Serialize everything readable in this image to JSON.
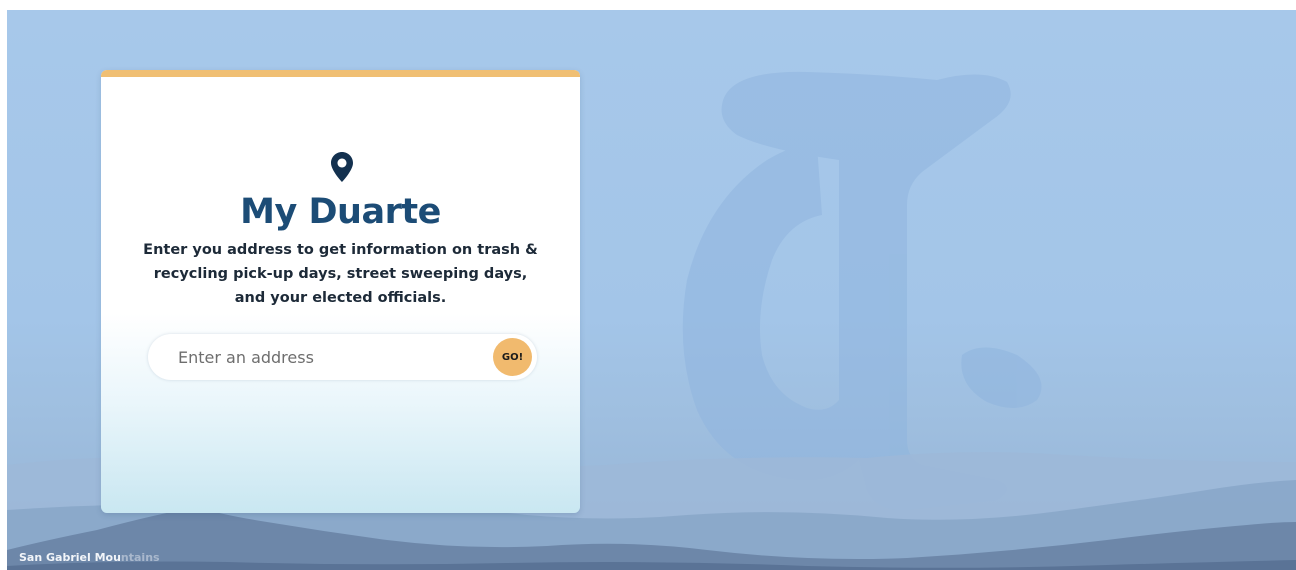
{
  "card": {
    "title": "My Duarte",
    "description": "Enter you address to get information on trash & recycling pick-up days, street sweeping days, and your elected officials."
  },
  "search": {
    "placeholder": "Enter an address",
    "value": "",
    "go_label": "GO!"
  },
  "photo_caption": {
    "visible": "San Gabriel Mou",
    "faded": "ntains"
  },
  "colors": {
    "accent": "#f0bf73",
    "title": "#1c4c76",
    "background_sky": "#a7c8ea",
    "go_button": "#f1ba6e"
  },
  "icons": {
    "location": "map-pin-icon"
  }
}
